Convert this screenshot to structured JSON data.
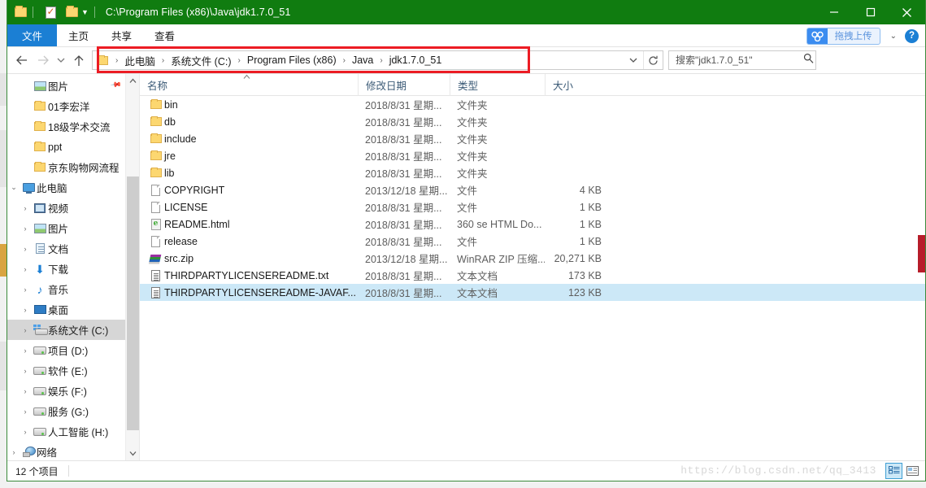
{
  "window": {
    "title": "C:\\Program Files (x86)\\Java\\jdk1.7.0_51",
    "minimize_label": "—",
    "maximize_label": "□",
    "close_label": "✕",
    "accent_color": "#107c10",
    "quick_access": [
      {
        "name": "new-folder-icon",
        "label": "新建文件夹"
      },
      {
        "name": "properties-icon",
        "label": "属性"
      },
      {
        "name": "open-folder-icon",
        "label": "打开"
      },
      {
        "name": "customize-caret-icon",
        "label": "自定义快速访问工具栏"
      }
    ]
  },
  "ribbon": {
    "tabs": [
      {
        "label": "文件",
        "active": true
      },
      {
        "label": "主页",
        "active": false
      },
      {
        "label": "共享",
        "active": false
      },
      {
        "label": "查看",
        "active": false
      }
    ],
    "netdisk_upload_label": "拖拽上传",
    "expand_caret": "⌄",
    "help_label": "?"
  },
  "address": {
    "back_label": "←",
    "forward_label": "→",
    "recent_label": "⌄",
    "up_label": "↑",
    "breadcrumbs": [
      "此电脑",
      "系统文件 (C:)",
      "Program Files (x86)",
      "Java",
      "jdk1.7.0_51"
    ],
    "separator": "›",
    "dropdown_label": "⌄",
    "refresh_label": "↻",
    "highlight_color": "#ec1c24"
  },
  "search": {
    "placeholder": "搜索\"jdk1.7.0_51\"",
    "value": "",
    "icon_label": "搜索"
  },
  "nav_pane": {
    "items": [
      {
        "label": "图片",
        "icon": "picture-icon",
        "indent": 1,
        "chevron": "",
        "pinned": true,
        "selected": false
      },
      {
        "label": "01李宏洋",
        "icon": "folder-icon",
        "indent": 1,
        "chevron": "",
        "pinned": false,
        "selected": false
      },
      {
        "label": "18级学术交流",
        "icon": "folder-icon",
        "indent": 1,
        "chevron": "",
        "pinned": false,
        "selected": false
      },
      {
        "label": "ppt",
        "icon": "folder-icon",
        "indent": 1,
        "chevron": "",
        "pinned": false,
        "selected": false
      },
      {
        "label": "京东购物网流程",
        "icon": "folder-icon",
        "indent": 1,
        "chevron": "",
        "pinned": false,
        "selected": false
      },
      {
        "label": "此电脑",
        "icon": "computer-icon",
        "indent": 0,
        "chevron": "⌄",
        "pinned": false,
        "selected": false
      },
      {
        "label": "视频",
        "icon": "video-icon",
        "indent": 1,
        "chevron": "›",
        "pinned": false,
        "selected": false
      },
      {
        "label": "图片",
        "icon": "picture-icon",
        "indent": 1,
        "chevron": "›",
        "pinned": false,
        "selected": false
      },
      {
        "label": "文档",
        "icon": "document-icon",
        "indent": 1,
        "chevron": "›",
        "pinned": false,
        "selected": false
      },
      {
        "label": "下载",
        "icon": "download-icon",
        "indent": 1,
        "chevron": "›",
        "pinned": false,
        "selected": false
      },
      {
        "label": "音乐",
        "icon": "music-icon",
        "indent": 1,
        "chevron": "›",
        "pinned": false,
        "selected": false
      },
      {
        "label": "桌面",
        "icon": "desktop-icon",
        "indent": 1,
        "chevron": "›",
        "pinned": false,
        "selected": false
      },
      {
        "label": "系统文件 (C:)",
        "icon": "system-drive-icon",
        "indent": 1,
        "chevron": "›",
        "pinned": false,
        "selected": true
      },
      {
        "label": "项目 (D:)",
        "icon": "drive-icon",
        "indent": 1,
        "chevron": "›",
        "pinned": false,
        "selected": false
      },
      {
        "label": "软件 (E:)",
        "icon": "drive-icon",
        "indent": 1,
        "chevron": "›",
        "pinned": false,
        "selected": false
      },
      {
        "label": "娱乐 (F:)",
        "icon": "drive-icon",
        "indent": 1,
        "chevron": "›",
        "pinned": false,
        "selected": false
      },
      {
        "label": "服务 (G:)",
        "icon": "drive-icon",
        "indent": 1,
        "chevron": "›",
        "pinned": false,
        "selected": false
      },
      {
        "label": "人工智能 (H:)",
        "icon": "drive-icon",
        "indent": 1,
        "chevron": "›",
        "pinned": false,
        "selected": false
      },
      {
        "label": "网络",
        "icon": "network-icon",
        "indent": 0,
        "chevron": "›",
        "pinned": false,
        "selected": false
      }
    ],
    "scroll_up_label": "⌃",
    "scroll_down_label": "⌄"
  },
  "file_list": {
    "columns": [
      {
        "label": "名称",
        "key": "name"
      },
      {
        "label": "修改日期",
        "key": "date"
      },
      {
        "label": "类型",
        "key": "type"
      },
      {
        "label": "大小",
        "key": "size"
      }
    ],
    "sort_indicator": "⌃",
    "rows": [
      {
        "name": "bin",
        "date": "2018/8/31 星期...",
        "type": "文件夹",
        "size": "",
        "icon": "folder-icon",
        "selected": false
      },
      {
        "name": "db",
        "date": "2018/8/31 星期...",
        "type": "文件夹",
        "size": "",
        "icon": "folder-icon",
        "selected": false
      },
      {
        "name": "include",
        "date": "2018/8/31 星期...",
        "type": "文件夹",
        "size": "",
        "icon": "folder-icon",
        "selected": false
      },
      {
        "name": "jre",
        "date": "2018/8/31 星期...",
        "type": "文件夹",
        "size": "",
        "icon": "folder-icon",
        "selected": false
      },
      {
        "name": "lib",
        "date": "2018/8/31 星期...",
        "type": "文件夹",
        "size": "",
        "icon": "folder-icon",
        "selected": false
      },
      {
        "name": "COPYRIGHT",
        "date": "2013/12/18 星期...",
        "type": "文件",
        "size": "4 KB",
        "icon": "file-icon",
        "selected": false
      },
      {
        "name": "LICENSE",
        "date": "2018/8/31 星期...",
        "type": "文件",
        "size": "1 KB",
        "icon": "file-icon",
        "selected": false
      },
      {
        "name": "README.html",
        "date": "2018/8/31 星期...",
        "type": "360 se HTML Do...",
        "size": "1 KB",
        "icon": "html-file-icon",
        "selected": false
      },
      {
        "name": "release",
        "date": "2018/8/31 星期...",
        "type": "文件",
        "size": "1 KB",
        "icon": "file-icon",
        "selected": false
      },
      {
        "name": "src.zip",
        "date": "2013/12/18 星期...",
        "type": "WinRAR ZIP 压缩...",
        "size": "20,271 KB",
        "icon": "zip-file-icon",
        "selected": false
      },
      {
        "name": "THIRDPARTYLICENSEREADME.txt",
        "date": "2018/8/31 星期...",
        "type": "文本文档",
        "size": "173 KB",
        "icon": "text-file-icon",
        "selected": false
      },
      {
        "name": "THIRDPARTYLICENSEREADME-JAVAF...",
        "date": "2018/8/31 星期...",
        "type": "文本文档",
        "size": "123 KB",
        "icon": "text-file-icon",
        "selected": true
      }
    ]
  },
  "status_bar": {
    "item_count": "12 个项目",
    "watermark": "https://blog.csdn.net/qq_3413",
    "view_details_label": "详细信息",
    "view_large_icons_label": "大图标"
  }
}
